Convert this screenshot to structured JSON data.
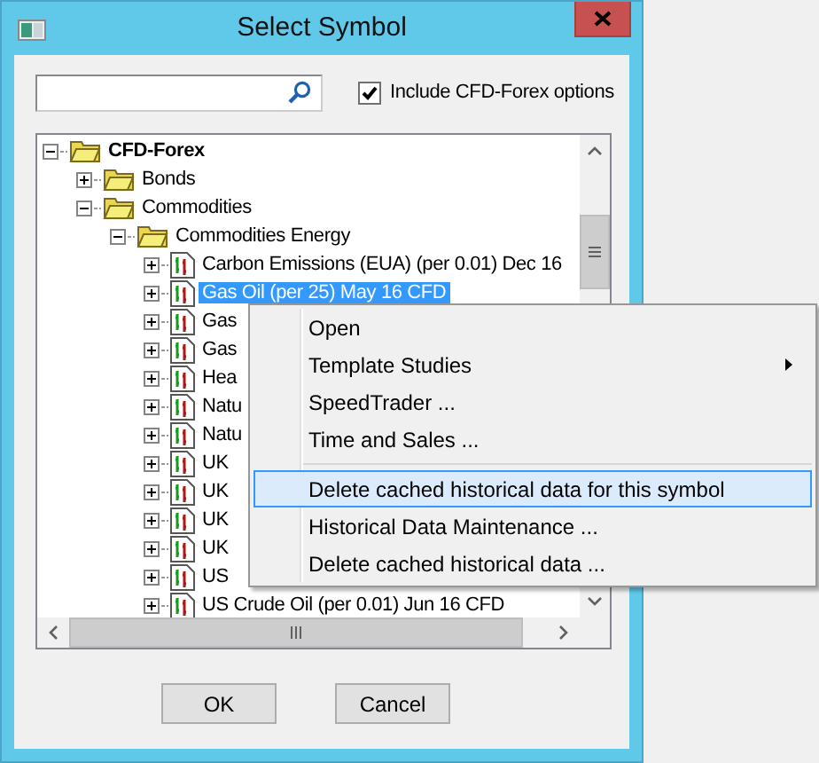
{
  "window": {
    "title": "Select Symbol"
  },
  "include_option": {
    "label": "Include CFD-Forex options",
    "checked": true
  },
  "tree": [
    {
      "label": "CFD-Forex",
      "kind": "root",
      "expanded": true,
      "children": [
        {
          "label": "Bonds",
          "kind": "folder",
          "expanded": false
        },
        {
          "label": "Commodities",
          "kind": "folder",
          "expanded": true,
          "children": [
            {
              "label": "Commodities Energy",
              "kind": "folder",
              "expanded": true,
              "children": [
                {
                  "label": "Carbon Emissions (EUA) (per 0.01) Dec 16",
                  "kind": "symbol",
                  "expanded": false,
                  "selected": false
                },
                {
                  "label": "Gas Oil (per 25) May 16 CFD",
                  "kind": "symbol",
                  "expanded": false,
                  "selected": true
                },
                {
                  "label": "Gas",
                  "kind": "symbol",
                  "expanded": false,
                  "selected": false
                },
                {
                  "label": "Gas",
                  "kind": "symbol",
                  "expanded": false,
                  "selected": false
                },
                {
                  "label": "Hea",
                  "kind": "symbol",
                  "expanded": false,
                  "selected": false
                },
                {
                  "label": "Natu",
                  "kind": "symbol",
                  "expanded": false,
                  "selected": false
                },
                {
                  "label": "Natu",
                  "kind": "symbol",
                  "expanded": false,
                  "selected": false
                },
                {
                  "label": "UK",
                  "kind": "symbol",
                  "expanded": false,
                  "selected": false
                },
                {
                  "label": "UK",
                  "kind": "symbol",
                  "expanded": false,
                  "selected": false
                },
                {
                  "label": "UK",
                  "kind": "symbol",
                  "expanded": false,
                  "selected": false
                },
                {
                  "label": "UK",
                  "kind": "symbol",
                  "expanded": false,
                  "selected": false
                },
                {
                  "label": "US",
                  "kind": "symbol",
                  "expanded": false,
                  "selected": false
                },
                {
                  "label": "US Crude Oil (per 0.01) Jun 16 CFD",
                  "kind": "symbol",
                  "expanded": false,
                  "selected": false
                }
              ]
            }
          ]
        }
      ]
    }
  ],
  "context_menu": [
    {
      "kind": "item",
      "label": "Open",
      "selected": false
    },
    {
      "kind": "item",
      "label": "Template Studies",
      "selected": false,
      "submenu": true
    },
    {
      "kind": "item",
      "label": "SpeedTrader ...",
      "selected": false
    },
    {
      "kind": "item",
      "label": "Time and Sales ...",
      "selected": false
    },
    {
      "kind": "separator"
    },
    {
      "kind": "item",
      "label": "Delete cached historical data for this symbol",
      "selected": true
    },
    {
      "kind": "item",
      "label": "Historical Data Maintenance ...",
      "selected": false
    },
    {
      "kind": "item",
      "label": "Delete cached historical data ...",
      "selected": false
    }
  ],
  "buttons": [
    "OK",
    "Cancel"
  ]
}
